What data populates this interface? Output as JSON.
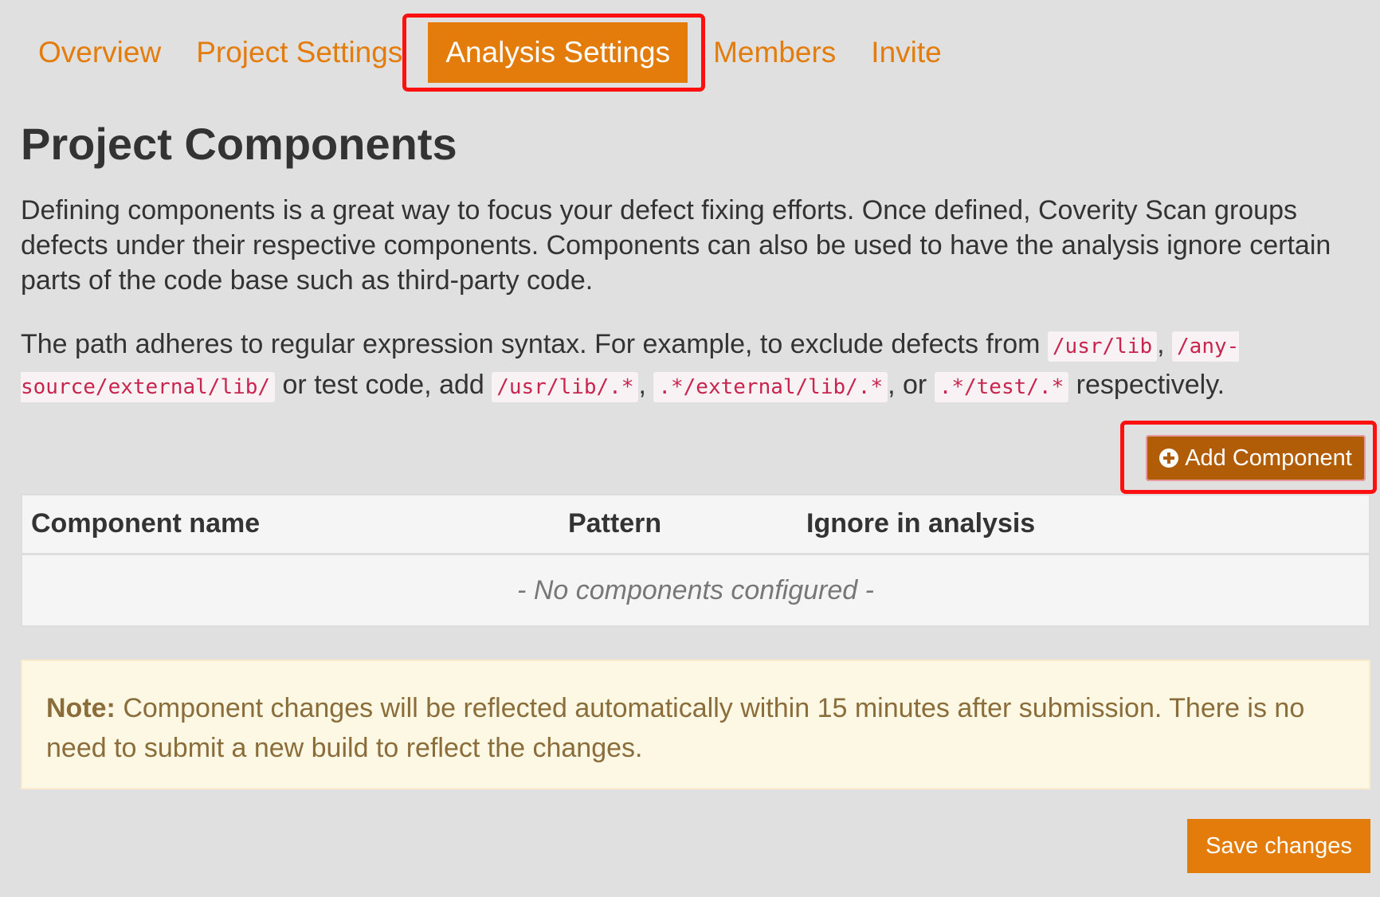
{
  "tabs": [
    {
      "label": "Overview",
      "active": false
    },
    {
      "label": "Project Settings",
      "active": false
    },
    {
      "label": "Analysis Settings",
      "active": true
    },
    {
      "label": "Members",
      "active": false
    },
    {
      "label": "Invite",
      "active": false
    }
  ],
  "page_title": "Project Components",
  "intro_text": "Defining components is a great way to focus your defect fixing efforts. Once defined, Coverity Scan groups defects under their respective components. Components can also be used to have the analysis ignore certain parts of the code base such as third-party code.",
  "path_text": {
    "t1": "The path adheres to regular expression syntax. For example, to exclude defects from ",
    "c1": "/usr/lib",
    "t2": ", ",
    "c2": "/any-source/external/lib/",
    "t3": " or test code, add ",
    "c3": "/usr/lib/.*",
    "t4": ", ",
    "c4": ".*/external/lib/.*",
    "t5": ", or ",
    "c5": ".*/test/.*",
    "t6": " respectively."
  },
  "add_component_button": {
    "label": "Add Component",
    "icon": "plus-circle-icon"
  },
  "table": {
    "headers": [
      "Component name",
      "Pattern",
      "Ignore in analysis"
    ],
    "empty_message": "- No components configured -"
  },
  "note": {
    "label": "Note:",
    "text": " Component changes will be reflected automatically within 15 minutes after submission. There is no need to submit a new build to reflect the changes."
  },
  "save_button": {
    "label": "Save changes"
  },
  "colors": {
    "accent": "#e37c0a",
    "add_button": "#b15d08",
    "highlight": "#ff1010",
    "note_bg": "#fcf8e3",
    "note_text": "#8a6d3b"
  }
}
